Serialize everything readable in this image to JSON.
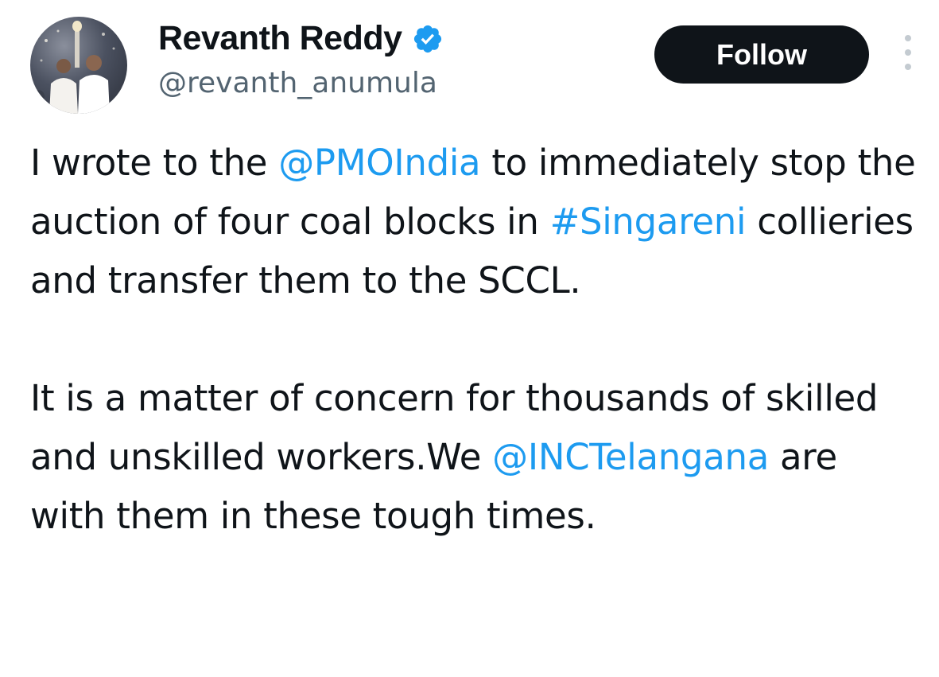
{
  "author": {
    "display_name": "Revanth Reddy",
    "handle": "@revanth_anumula",
    "verified_icon": "verified-badge-icon",
    "verified_color": "#1d9bf0"
  },
  "follow_button": {
    "label": "Follow"
  },
  "more_menu": {
    "icon": "more-vertical-icon"
  },
  "tweet": {
    "paragraph1": {
      "t1": "I wrote to the ",
      "mention_pmo": "@PMOIndia",
      "t2": " to immediately stop the auction of four coal blocks in ",
      "hashtag_singareni": "#Singareni",
      "t3": " collieries and transfer them to the SCCL."
    },
    "paragraph2": {
      "t1": "It is a matter of concern for thousands of skilled and unskilled workers.We ",
      "mention_inc": "@INCTelangana",
      "t2": " are with them in these tough times."
    }
  },
  "colors": {
    "text": "#0f1419",
    "secondary_text": "#536471",
    "link": "#1d9bf0",
    "button_bg": "#0f1419",
    "button_text": "#ffffff"
  }
}
